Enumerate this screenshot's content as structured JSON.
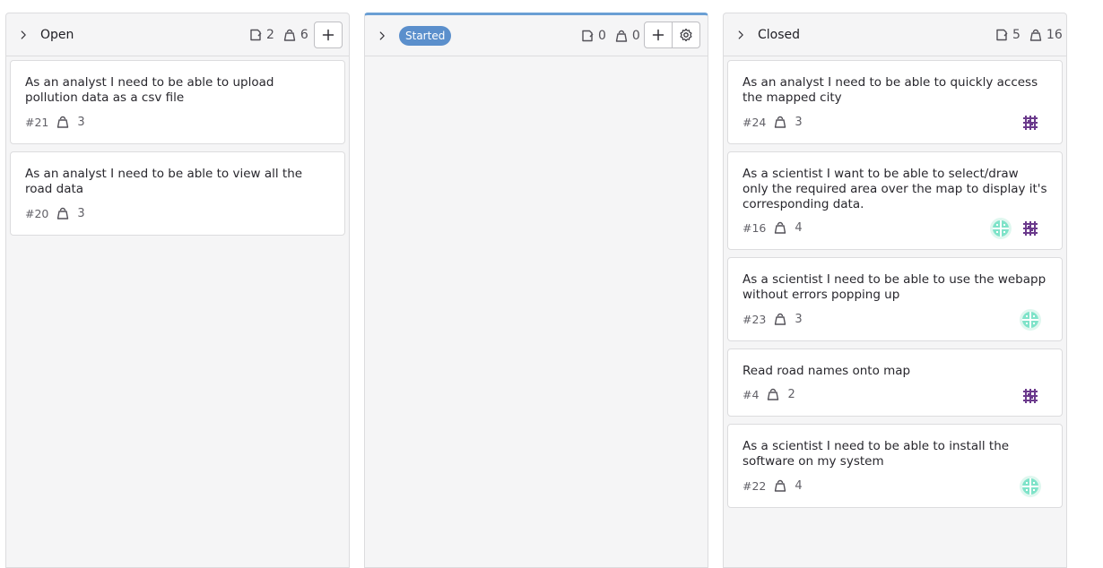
{
  "columns": [
    {
      "title": "Open",
      "issue_count": "2",
      "weight": "6",
      "cards": [
        {
          "title": "As an analyst I need to be able to upload pollution data as a csv file",
          "ref": "#21",
          "weight": "3"
        },
        {
          "title": "As an analyst I need to be able to view all the road data",
          "ref": "#20",
          "weight": "3"
        }
      ]
    },
    {
      "title": "Started",
      "issue_count": "0",
      "weight": "0",
      "cards": []
    },
    {
      "title": "Closed",
      "issue_count": "5",
      "weight": "16",
      "cards": [
        {
          "title": "As an analyst I need to be able to quickly access the mapped city",
          "ref": "#24",
          "weight": "3",
          "avatars": [
            "purple-identicon"
          ]
        },
        {
          "title": "As a scientist I want to be able to select/draw only the required area over the map to display it's corresponding data.",
          "ref": "#16",
          "weight": "4",
          "avatars": [
            "teal-identicon",
            "purple-identicon"
          ]
        },
        {
          "title": "As a scientist I need to be able to use the webapp without errors popping up",
          "ref": "#23",
          "weight": "3",
          "avatars": [
            "teal-identicon"
          ]
        },
        {
          "title": "Read road names onto map",
          "ref": "#4",
          "weight": "2",
          "avatars": [
            "purple-identicon"
          ]
        },
        {
          "title": "As a scientist I need to be able to install the software on my system",
          "ref": "#22",
          "weight": "4",
          "avatars": [
            "teal-identicon"
          ]
        }
      ]
    }
  ],
  "colors": {
    "started_accent": "#6a9fd4",
    "started_pill": "#5b8fcc",
    "avatar_purple": "#6b3a8c",
    "avatar_teal": "#7fe3c9"
  }
}
